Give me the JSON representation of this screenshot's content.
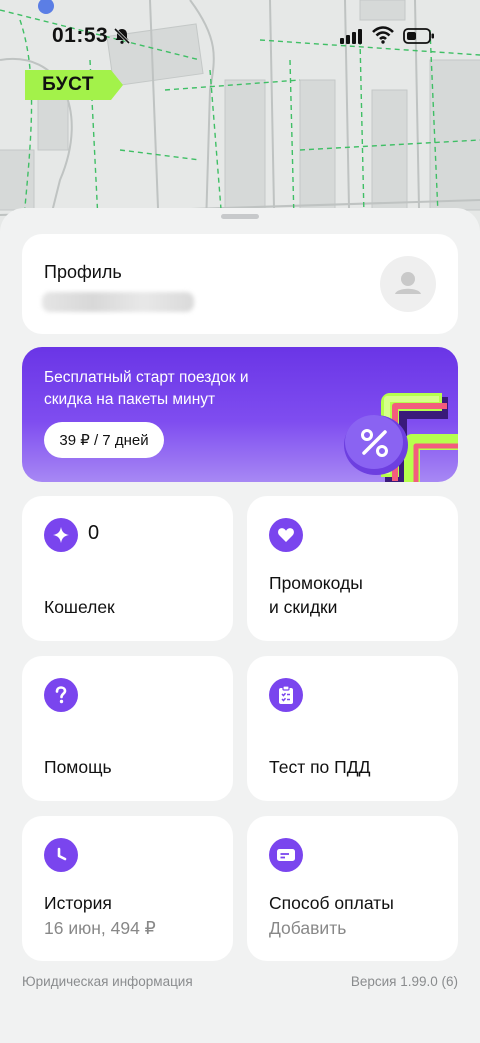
{
  "status": {
    "time": "01:53"
  },
  "brand": {
    "logo_text": "БУСТ",
    "accent": "#a3f24a"
  },
  "profile": {
    "title": "Профиль"
  },
  "promo": {
    "text": "Бесплатный старт поездок и скидка на пакеты минут",
    "button": "39 ₽ / 7 дней"
  },
  "tiles": {
    "wallet": {
      "count": "0",
      "label": "Кошелек"
    },
    "promocodes": {
      "line1": "Промокоды",
      "line2": "и скидки"
    },
    "help": {
      "label": "Помощь"
    },
    "test": {
      "label": "Тест по ПДД"
    },
    "history": {
      "label": "История",
      "sub": "16 июн, 494 ₽"
    },
    "payment": {
      "label": "Способ оплаты",
      "sub": "Добавить"
    }
  },
  "footer": {
    "legal": "Юридическая информация",
    "version": "Версия 1.99.0 (6)"
  },
  "colors": {
    "primary": "#7a45ee",
    "promo_bg": "#6a35e6"
  },
  "icons": [
    "bell-off-icon",
    "signal-icon",
    "wifi-icon",
    "battery-icon",
    "avatar-icon",
    "sparkle-icon",
    "heart-icon",
    "question-icon",
    "checklist-icon",
    "clock-icon",
    "card-icon",
    "percent-icon"
  ]
}
